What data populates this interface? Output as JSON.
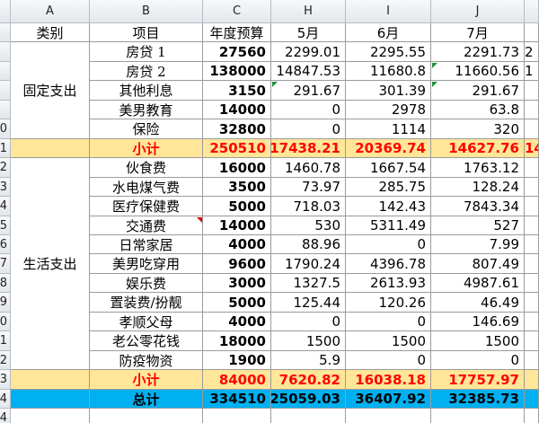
{
  "columns": [
    "",
    "A",
    "B",
    "C",
    "H",
    "I",
    "J",
    ""
  ],
  "row_numbers": [
    "",
    "",
    "",
    "",
    "",
    "0",
    "1",
    "2",
    "3",
    "4",
    "5",
    "6",
    "7",
    "8",
    "9",
    "0",
    "1",
    "2",
    "3",
    "4"
  ],
  "header_row": {
    "category": "类别",
    "item": "项目",
    "budget": "年度预算",
    "m5": "5月",
    "m6": "6月",
    "m7": "7月"
  },
  "categories": {
    "fixed": "固定支出",
    "living": "生活支出"
  },
  "rows": [
    {
      "item": "房贷 1",
      "budget": "27560",
      "m5": "2299.01",
      "m6": "2295.55",
      "m7": "2291.73",
      "extra": "2"
    },
    {
      "item": "房贷 2",
      "budget": "138000",
      "m5": "14847.53",
      "m6": "11680.8",
      "m7": "11660.56",
      "extra": "1"
    },
    {
      "item": "其他利息",
      "budget": "3150",
      "m5": "291.67",
      "m6": "301.39",
      "m7": "291.67",
      "extra": ""
    },
    {
      "item": "美男教育",
      "budget": "14000",
      "m5": "0",
      "m6": "2978",
      "m7": "63.8",
      "extra": ""
    },
    {
      "item": "保险",
      "budget": "32800",
      "m5": "0",
      "m6": "1114",
      "m7": "320",
      "extra": ""
    },
    {
      "item": "小计",
      "budget": "250510",
      "m5": "17438.21",
      "m6": "20369.74",
      "m7": "14627.76",
      "extra": "14"
    },
    {
      "item": "伙食费",
      "budget": "16000",
      "m5": "1460.78",
      "m6": "1667.54",
      "m7": "1763.12",
      "extra": ""
    },
    {
      "item": "水电煤气费",
      "budget": "3500",
      "m5": "73.97",
      "m6": "285.75",
      "m7": "128.24",
      "extra": ""
    },
    {
      "item": "医疗保健费",
      "budget": "5000",
      "m5": "718.03",
      "m6": "142.43",
      "m7": "7843.34",
      "extra": ""
    },
    {
      "item": "交通费",
      "budget": "14000",
      "m5": "530",
      "m6": "5311.49",
      "m7": "527",
      "extra": ""
    },
    {
      "item": "日常家居",
      "budget": "4000",
      "m5": "88.96",
      "m6": "0",
      "m7": "7.99",
      "extra": ""
    },
    {
      "item": "美男吃穿用",
      "budget": "9600",
      "m5": "1790.24",
      "m6": "4396.78",
      "m7": "807.49",
      "extra": ""
    },
    {
      "item": "娱乐费",
      "budget": "3000",
      "m5": "1327.5",
      "m6": "2613.93",
      "m7": "4987.61",
      "extra": ""
    },
    {
      "item": "置装费/扮靓",
      "budget": "5000",
      "m5": "125.44",
      "m6": "120.26",
      "m7": "46.49",
      "extra": ""
    },
    {
      "item": "孝顺父母",
      "budget": "4000",
      "m5": "0",
      "m6": "0",
      "m7": "146.69",
      "extra": ""
    },
    {
      "item": "老公零花钱",
      "budget": "18000",
      "m5": "1500",
      "m6": "1500",
      "m7": "1500",
      "extra": ""
    },
    {
      "item": "防疫物资",
      "budget": "1900",
      "m5": "5.9",
      "m6": "0",
      "m7": "0",
      "extra": ""
    },
    {
      "item": "小计",
      "budget": "84000",
      "m5": "7620.82",
      "m6": "16038.18",
      "m7": "17757.97",
      "extra": ""
    },
    {
      "item": "总计",
      "budget": "334510",
      "m5": "25059.03",
      "m6": "36407.92",
      "m7": "32385.73",
      "extra": ""
    }
  ],
  "colors": {
    "subtotal_fill": "#ffe699",
    "subtotal_text": "#ff0000",
    "total_fill": "#00b0f0",
    "grid": "#9b9b9b"
  }
}
